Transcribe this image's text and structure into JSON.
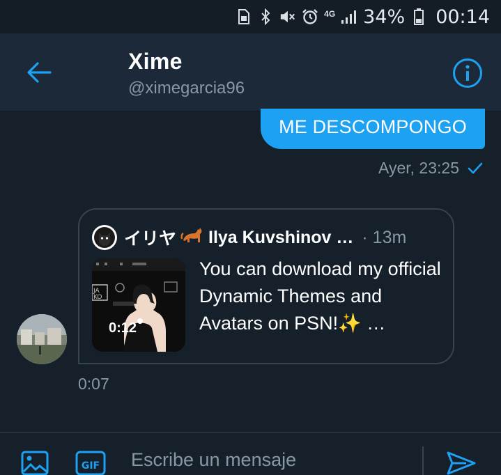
{
  "status_bar": {
    "network": "4G",
    "battery": "34%",
    "clock": "00:14"
  },
  "header": {
    "name": "Xime",
    "handle": "@ximegarcia96"
  },
  "messages": {
    "sent": {
      "text": "ME DESCOMPONGO",
      "time": "Ayer, 23:25"
    },
    "received": {
      "card": {
        "author": "イリヤ",
        "author_name": "Ilya Kuvshinov …",
        "time": "· 13m",
        "duration": "0:12",
        "text": "You can download my official Dynamic Themes and Avatars on PSN!✨ …"
      },
      "time": "0:07"
    }
  },
  "composer": {
    "placeholder": "Escribe un mensaje"
  },
  "colors": {
    "background": "#15202b",
    "header": "#1c2938",
    "accent": "#1da1f2",
    "muted": "#8899a6"
  },
  "icons": [
    "back-arrow-icon",
    "info-icon",
    "image-icon",
    "gif-icon",
    "send-icon",
    "read-check-icon"
  ]
}
